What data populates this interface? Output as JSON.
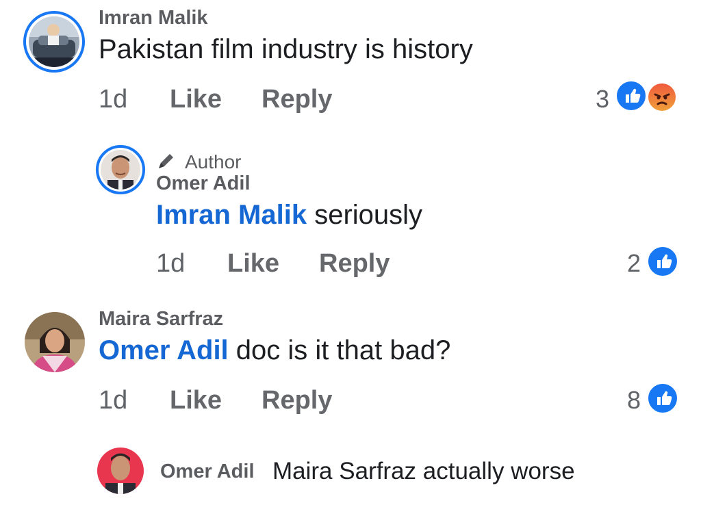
{
  "comments": [
    {
      "author": "Imran Malik",
      "text": "Pakistan film industry is history",
      "time": "1d",
      "like_label": "Like",
      "reply_label": "Reply",
      "reaction_count": "3",
      "reactions": [
        "like-icon",
        "angry-icon"
      ]
    },
    {
      "badge": "Author",
      "author": "Omer Adil",
      "mention": "Imran Malik",
      "text": "seriously",
      "time": "1d",
      "like_label": "Like",
      "reply_label": "Reply",
      "reaction_count": "2",
      "reactions": [
        "like-icon"
      ]
    },
    {
      "author": "Maira Sarfraz",
      "mention": "Omer Adil",
      "text": "doc is it that bad?",
      "time": "1d",
      "like_label": "Like",
      "reply_label": "Reply",
      "reaction_count": "8",
      "reactions": [
        "like-icon"
      ]
    },
    {
      "author": "Omer Adil",
      "text": "Maira Sarfraz actually worse"
    }
  ],
  "colors": {
    "accent": "#1877f2",
    "mention": "#1567d3",
    "meta": "#65676b",
    "angry": "#f05a3e"
  }
}
